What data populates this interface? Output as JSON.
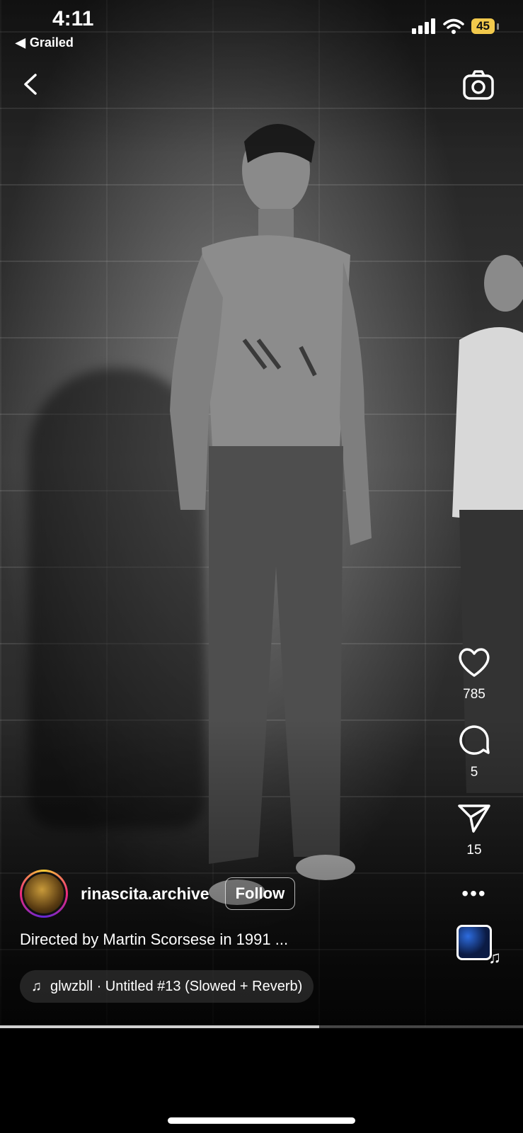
{
  "status_bar": {
    "time": "4:11",
    "back_app": "Grailed",
    "battery": "45"
  },
  "post": {
    "username": "rinascita.archive",
    "follow_label": "Follow",
    "caption": "Directed by Martin Scorsese in 1991 ...",
    "audio": "glwzbll · Untitled #13 (Slowed + Reverb)"
  },
  "actions": {
    "likes": "785",
    "comments": "5",
    "shares": "15"
  },
  "playback": {
    "progress": 0.61
  },
  "icons": [
    "chevron-left-icon",
    "camera-icon",
    "heart-icon",
    "comment-icon",
    "send-icon",
    "more-icon",
    "music-note-icon"
  ]
}
